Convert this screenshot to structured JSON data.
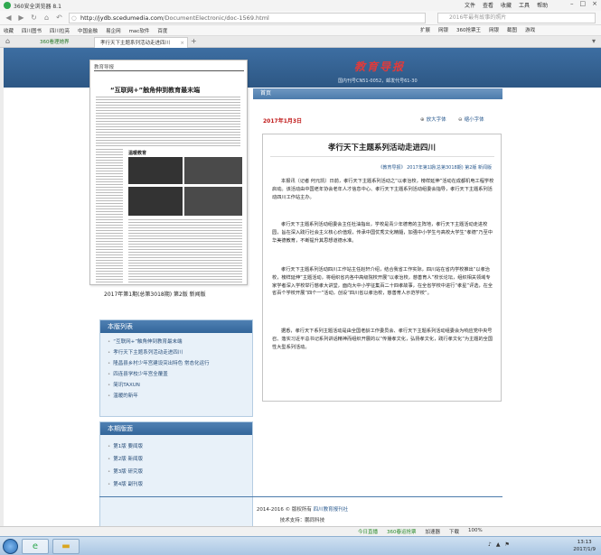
{
  "browser": {
    "app_title": "360安全浏览器 8.1",
    "menus": [
      "文件",
      "查看",
      "收藏",
      "工具",
      "帮助"
    ],
    "url_host": "http://jydb.scedumedia.com",
    "url_path": "/DocumentElectronic/doc-1569.html",
    "search_placeholder": "2016年最有故事的照片",
    "bookmarks": [
      "收藏",
      "四川图书",
      "四川拉亮",
      "中国金融",
      "易企网",
      "mac软件",
      "百度"
    ],
    "bookmark_tools": [
      "扩展",
      "网银",
      "360抢票王",
      "网银",
      "截图",
      "游戏"
    ],
    "tabs": [
      {
        "label": "360看理她界"
      },
      {
        "label": "孝行天下主题系列活动走进四川"
      }
    ]
  },
  "site": {
    "name": "教育导报",
    "issn": "国内刊号CN51-0052，邮发代号61-30",
    "breadcrumb": "首页"
  },
  "thumbnail": {
    "masthead": "教育导报",
    "headline": "“互联网+”触角伸到教育最末端",
    "sub_heading": "温暖教育",
    "caption": "2017年第1期(总第3018期) 第2版 新闻版"
  },
  "article_list": {
    "title": "本版列表",
    "items": [
      "“互联网+”触角伸到教育最末端",
      "孝行天下主题系列活动走进四川",
      "隆昌县乡村少年宫建设突出特色 常态化运行",
      "四连县学校少年宫全覆盖",
      "简讯TAXUN",
      "温暖的新年"
    ]
  },
  "edition_list": {
    "title": "本期版面",
    "items": [
      "第1版 要闻版",
      "第2版 新闻版",
      "第3版 研究版",
      "第4版 副刊版"
    ]
  },
  "article": {
    "date": "2017年1月3日",
    "font_increase": "放大字体",
    "font_decrease": "缩小字体",
    "title": "孝行天下主题系列活动走进四川",
    "meta": "《教育导报》 2017年第1期(总第3018期) 第2版 新闻版",
    "paragraphs": [
      "本报讯（记者 何元凯）日前，孝行天下主题系列活动之“以孝治校，榜样延伸”活动在成都机电工程学校启动。该活动由中国老年协会老年人才信息中心、孝行天下主题系列活动组委会指导，孝行天下主题系列活动四川工作站主办。",
      "孝行天下主题系列活动组委会主任杜油指出，学校是青少年德育的主阵地，孝行天下主题活动走进校园，旨在深入践行社会主义核心价值观，传承中国优秀文化精髓，加强中小学生与高校大学生“孝德”乃至中华美德教育，不断提升其思想道德水准。",
      "孝行天下主题系列活动四川工作站主任赵轩介绍，结合我省工作实际，四川站在省内学校推出“以孝治校，榜样延伸”主题活动，将组织省内各中高级院校开展“以孝治校，慈善育人”校长论坛，组织相关领域专家学者深入学校举行慈孝大讲堂，面向大中小学征集百二十四孝故事，在全省学校中进行“孝星”评选，在全省百个学校开展“四个一”活动，创设“四川省以孝治校，慈善育人示范学校”。",
      "据悉，孝行天下系列主题活动是由全国老龄工作委员会、孝行天下主题系列活动组委会为响应党中央号召、落实习近平总书记系列讲话精神而组织开展的以“传播孝文化，弘扬孝文化，践行孝文化”为主题的全国性大型系列活动。"
    ]
  },
  "footer": {
    "copyright": "2014-2016 © 版权所有",
    "owner_link": "四川教育报刊社",
    "support": "技术支持：鹏同科技"
  },
  "status_bar": [
    "今日直播",
    "360春运抢票",
    "加速器",
    "下载",
    "100%"
  ],
  "taskbar": {
    "time": "13:13",
    "date": "2017/1/9"
  }
}
